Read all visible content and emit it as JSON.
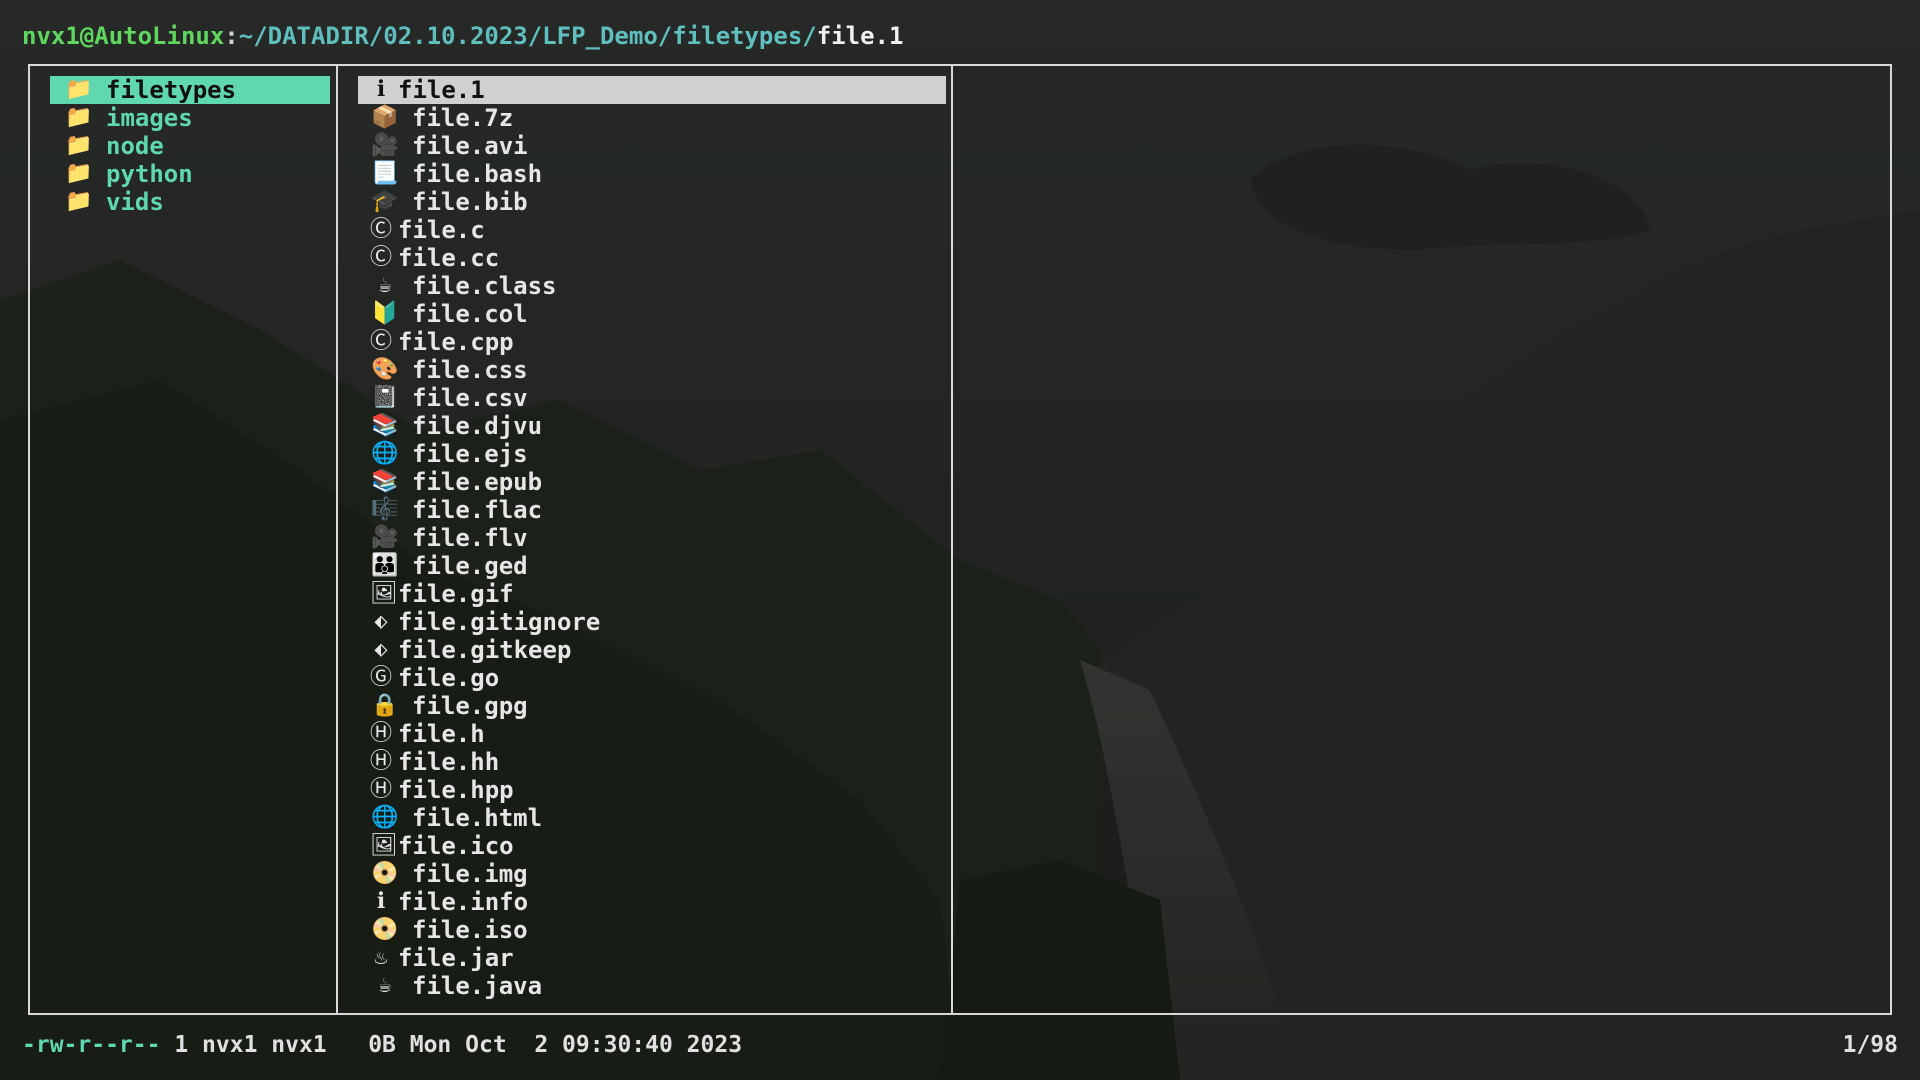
{
  "prompt": {
    "user_host": "nvx1@AutoLinux",
    "separator": ":",
    "path": "~/DATADIR/02.10.2023/LFP_Demo/filetypes/",
    "filename": "file.1"
  },
  "parent_dirs": [
    {
      "icon": "folder-icon",
      "glyph": "📁",
      "label": "filetypes",
      "selected": true
    },
    {
      "icon": "folder-icon",
      "glyph": "📁",
      "label": "images"
    },
    {
      "icon": "folder-icon",
      "glyph": "📁",
      "label": "node"
    },
    {
      "icon": "folder-icon",
      "glyph": "📁",
      "label": "python"
    },
    {
      "icon": "folder-icon",
      "glyph": "📁",
      "label": "vids"
    }
  ],
  "files": [
    {
      "icon": "info-icon",
      "glyph": "ℹ",
      "label": "file.1",
      "selected": true,
      "narrow": true
    },
    {
      "icon": "package-icon",
      "glyph": "📦",
      "label": "file.7z"
    },
    {
      "icon": "video-camera-icon",
      "glyph": "🎥",
      "label": "file.avi"
    },
    {
      "icon": "page-icon",
      "glyph": "📃",
      "label": "file.bash"
    },
    {
      "icon": "graduation-cap-icon",
      "glyph": "🎓",
      "label": "file.bib"
    },
    {
      "icon": "c-letter-icon",
      "glyph": "Ⓒ",
      "label": "file.c",
      "narrow": true
    },
    {
      "icon": "c-letter-icon",
      "glyph": "Ⓒ",
      "label": "file.cc",
      "narrow": true
    },
    {
      "icon": "coffee-icon",
      "glyph": "☕",
      "label": "file.class"
    },
    {
      "icon": "beginner-badge-icon",
      "glyph": "🔰",
      "label": "file.col"
    },
    {
      "icon": "c-letter-icon",
      "glyph": "Ⓒ",
      "label": "file.cpp",
      "narrow": true
    },
    {
      "icon": "palette-icon",
      "glyph": "🎨",
      "label": "file.css"
    },
    {
      "icon": "notebook-icon",
      "glyph": "📓",
      "label": "file.csv"
    },
    {
      "icon": "books-icon",
      "glyph": "📚",
      "label": "file.djvu"
    },
    {
      "icon": "globe-icon",
      "glyph": "🌐",
      "label": "file.ejs"
    },
    {
      "icon": "books-icon",
      "glyph": "📚",
      "label": "file.epub"
    },
    {
      "icon": "music-score-icon",
      "glyph": "🎼",
      "label": "file.flac"
    },
    {
      "icon": "video-camera-icon",
      "glyph": "🎥",
      "label": "file.flv"
    },
    {
      "icon": "family-icon",
      "glyph": "👪",
      "label": "file.ged"
    },
    {
      "icon": "framed-picture-icon",
      "glyph": "🖼",
      "label": "file.gif",
      "narrow": true
    },
    {
      "icon": "git-diamond-icon",
      "glyph": "⬖",
      "label": "file.gitignore",
      "narrow": true
    },
    {
      "icon": "git-diamond-icon",
      "glyph": "⬖",
      "label": "file.gitkeep",
      "narrow": true
    },
    {
      "icon": "g-letter-icon",
      "glyph": "Ⓖ",
      "label": "file.go",
      "narrow": true
    },
    {
      "icon": "lock-icon",
      "glyph": "🔒",
      "label": "file.gpg"
    },
    {
      "icon": "h-letter-icon",
      "glyph": "Ⓗ",
      "label": "file.h",
      "narrow": true
    },
    {
      "icon": "h-letter-icon",
      "glyph": "Ⓗ",
      "label": "file.hh",
      "narrow": true
    },
    {
      "icon": "h-letter-icon",
      "glyph": "Ⓗ",
      "label": "file.hpp",
      "narrow": true
    },
    {
      "icon": "globe-icon",
      "glyph": "🌐",
      "label": "file.html"
    },
    {
      "icon": "framed-picture-icon",
      "glyph": "🖼",
      "label": "file.ico",
      "narrow": true
    },
    {
      "icon": "disc-icon",
      "glyph": "📀",
      "label": "file.img"
    },
    {
      "icon": "info-icon",
      "glyph": "ℹ",
      "label": "file.info",
      "narrow": true
    },
    {
      "icon": "disc-icon",
      "glyph": "📀",
      "label": "file.iso"
    },
    {
      "icon": "hot-springs-icon",
      "glyph": "♨",
      "label": "file.jar",
      "narrow": true
    },
    {
      "icon": "coffee-icon",
      "glyph": "☕",
      "label": "file.java"
    }
  ],
  "status": {
    "permissions": "-rw-r--r--",
    "details": " 1 nvx1 nvx1   0B Mon Oct  2 09:30:40 2023",
    "position": "1/98"
  }
}
